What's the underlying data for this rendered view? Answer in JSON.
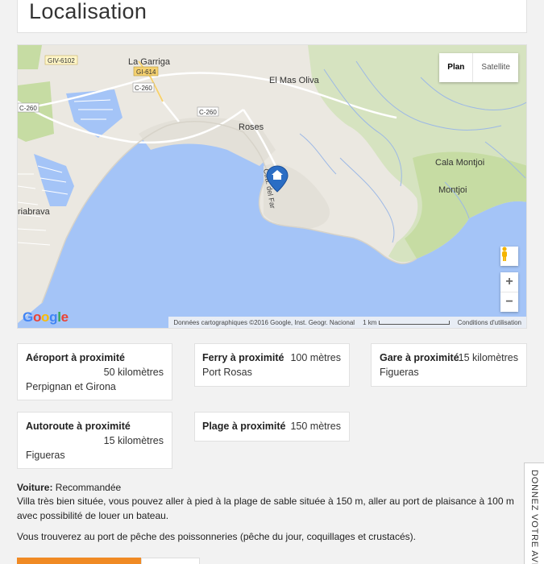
{
  "section": {
    "title": "Localisation"
  },
  "map": {
    "type_options": {
      "plan": "Plan",
      "satellite": "Satellite"
    },
    "labels": {
      "giv6102": "GIV-6102",
      "la_garriga": "La Garriga",
      "gi614": "GI-614",
      "c260_a": "C-260",
      "c260_b": "C-260",
      "c260_c": "C-260",
      "el_mas_oliva": "El Mas Oliva",
      "roses": "Roses",
      "cala_montjoi": "Cala Montjoi",
      "montjoi": "Montjoi",
      "riabrava": "riabrava",
      "ctra_del_far": "Ctra. del Far"
    },
    "zoom_in": "+",
    "zoom_out": "−",
    "google_letters": [
      "G",
      "o",
      "o",
      "g",
      "l",
      "e"
    ],
    "attribution": "Données cartographiques ©2016 Google, Inst. Geogr. Nacional",
    "scale": "1 km",
    "terms": "Conditions d'utilisation",
    "colors": {
      "water": "#a4c4f7",
      "land": "#ebe8e1",
      "green": "#c6dca3",
      "marker": "#2a6dc4"
    }
  },
  "proximity": [
    {
      "label": "Aéroport à proximité",
      "distance": "50 kilomètres",
      "place": "Perpignan et Girona"
    },
    {
      "label": "Ferry à proximité",
      "distance": "100 mètres",
      "place": "Port Rosas"
    },
    {
      "label": "Gare à proximité",
      "distance": "15 kilomètres",
      "place": "Figueras"
    },
    {
      "label": "Autoroute à proximité",
      "distance": "15 kilomètres",
      "place": "Figueras"
    },
    {
      "label": "Plage à proximité",
      "distance": "150 mètres",
      "place": ""
    }
  ],
  "voiture": {
    "label": "Voiture:",
    "value": "Recommandée",
    "paragraph1": "Villa très bien située, vous pouvez aller à pied à la plage de sable située à 150 m, aller au port de plaisance à 100 m avec possibilité de louer un bateau.",
    "paragraph2": "Vous trouverez au port de pêche des poissonneries (pêche du jour, coquillages et crustacés)."
  },
  "side_tab": {
    "label": "DONNEZ VOTRE AVIS"
  }
}
